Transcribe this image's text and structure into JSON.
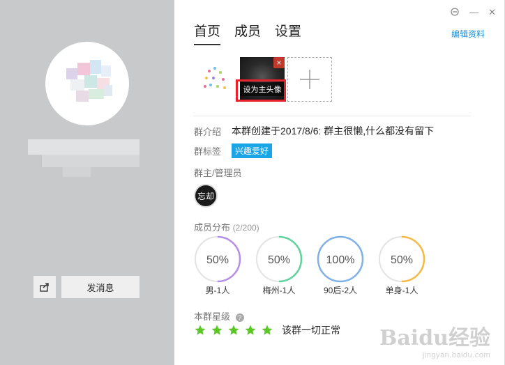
{
  "tabs": [
    {
      "label": "首页",
      "active": true
    },
    {
      "label": "成员",
      "active": false
    },
    {
      "label": "设置",
      "active": false
    }
  ],
  "edit_profile": "编辑资料",
  "photos": {
    "set_avatar_label": "设为主头像",
    "delete_symbol": "×",
    "add_symbol": "+"
  },
  "intro": {
    "label": "群介绍",
    "value": "本群创建于2017/8/6: 群主很懒,什么都没有留下"
  },
  "tags": {
    "label": "群标签",
    "tag": "兴趣爱好"
  },
  "admins": {
    "label": "群主/管理员",
    "avatar_text": "忘却"
  },
  "distribution": {
    "label": "成员分布",
    "count": "(2/200)",
    "items": [
      {
        "percent": 50,
        "display": "50%",
        "label": "男-1人",
        "color": "#b48ee8"
      },
      {
        "percent": 50,
        "display": "50%",
        "label": "梅州-1人",
        "color": "#5ed39b"
      },
      {
        "percent": 100,
        "display": "100%",
        "label": "90后-2人",
        "color": "#7fb0e6"
      },
      {
        "percent": 50,
        "display": "50%",
        "label": "单身-1人",
        "color": "#f5b946"
      }
    ]
  },
  "level": {
    "label": "本群星级",
    "help": "?",
    "stars": 5,
    "star_color": "#5cc626",
    "text": "该群一切正常"
  },
  "left": {
    "send_button": "发消息",
    "share_icon": "share-icon"
  },
  "window_controls": {
    "min": "—",
    "close": "✕"
  },
  "watermark": {
    "main": "Baidu经验",
    "sub": "jingyan.baidu.com"
  }
}
